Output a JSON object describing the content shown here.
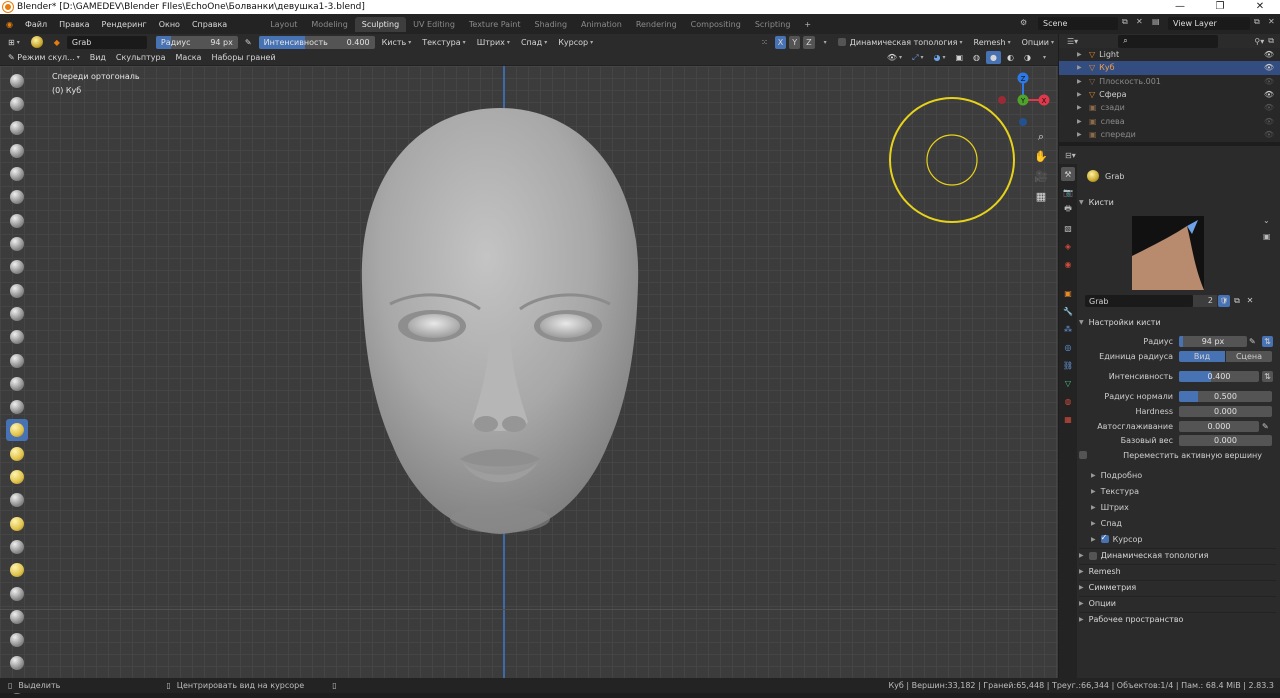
{
  "window": {
    "title": "Blender* [D:\\GAMEDEV\\Blender FIles\\EchoOne\\Болванки\\девушка1-3.blend]"
  },
  "menu": [
    "Файл",
    "Правка",
    "Рендеринг",
    "Окно",
    "Справка"
  ],
  "workspaces": [
    "Layout",
    "Modeling",
    "Sculpting",
    "UV Editing",
    "Texture Paint",
    "Shading",
    "Animation",
    "Rendering",
    "Compositing",
    "Scripting"
  ],
  "workspace_add": "+",
  "scene": {
    "name": "Scene",
    "view_layer": "View Layer"
  },
  "header": {
    "brush_name": "Grab",
    "radius_label": "Радиус",
    "radius_value": "94 px",
    "strength_label": "Интенсивность",
    "strength_value": "0.400",
    "strength_fraction": 0.4,
    "menus": [
      "Кисть",
      "Текстура",
      "Штрих",
      "Спад",
      "Курсор"
    ],
    "axes": [
      "X",
      "Y",
      "Z"
    ],
    "dyntopo": "Динамическая топология",
    "remesh": "Remesh",
    "options": "Опции"
  },
  "subheader": {
    "mode": "Режим скул...",
    "menus": [
      "Вид",
      "Скульптура",
      "Маска",
      "Наборы граней"
    ]
  },
  "viewport": {
    "view_name": "Спереди ортогональ",
    "object_info": "(0) Куб",
    "gizmo_axes": [
      "Z",
      "Y",
      "X"
    ]
  },
  "outliner": {
    "items": [
      {
        "name": "Light",
        "selected": false,
        "dim": false
      },
      {
        "name": "Куб",
        "selected": true,
        "dim": false
      },
      {
        "name": "Плоскость.001",
        "selected": false,
        "dim": true
      },
      {
        "name": "Сфера",
        "selected": false,
        "dim": false
      },
      {
        "name": "сзади",
        "selected": false,
        "dim": true
      },
      {
        "name": "слева",
        "selected": false,
        "dim": true
      },
      {
        "name": "спереди",
        "selected": false,
        "dim": true
      }
    ]
  },
  "properties": {
    "tool_name": "Grab",
    "brushes_panel": "Кисти",
    "brush_field": "Grab",
    "brush_users": "2",
    "brush_settings_panel": "Настройки кисти",
    "radius_label": "Радиус",
    "radius_value": "94 px",
    "radius_unit_label": "Единица радиуса",
    "radius_unit_view": "Вид",
    "radius_unit_scene": "Сцена",
    "strength_label": "Интенсивность",
    "strength_value": "0.400",
    "strength_fraction": 0.4,
    "normal_radius_label": "Радиус нормали",
    "normal_radius_value": "0.500",
    "normal_radius_fraction": 0.2,
    "hardness_label": "Hardness",
    "hardness_value": "0.000",
    "autosmooth_label": "Автосглаживание",
    "autosmooth_value": "0.000",
    "base_weight_label": "Базовый вес",
    "base_weight_value": "0.000",
    "move_active_vertex_label": "Переместить активную вершину",
    "subpanels": [
      "Подробно",
      "Текстура",
      "Штрих",
      "Спад",
      "Курсор"
    ],
    "panels": [
      "Динамическая топология",
      "Remesh",
      "Симметрия",
      "Опции",
      "Рабочее пространство"
    ]
  },
  "status": {
    "left_action": "Выделить",
    "mid_action": "Центрировать вид на курсоре",
    "stats": "Куб | Вершин:33,182 | Граней:65,448 | Треуг.:66,344 | Объектов:1/4 | Пам.: 68.4 MiB | 2.83.3"
  },
  "colors": {
    "accent": "#4772b3",
    "grab_circle": "#e6d21a",
    "panel": "#2b2b2b"
  }
}
